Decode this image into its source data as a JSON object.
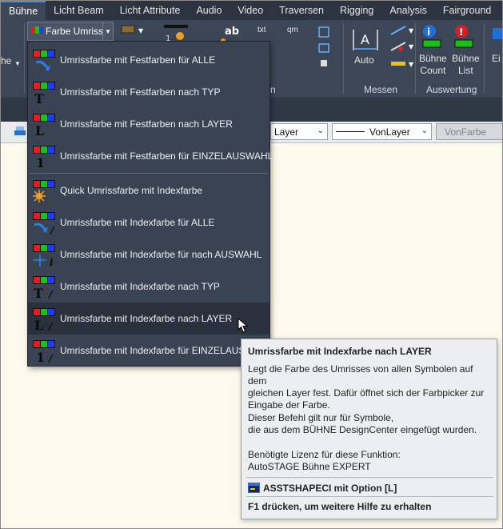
{
  "tabs": [
    {
      "label": "Bühne",
      "active": true
    },
    {
      "label": "Licht Beam"
    },
    {
      "label": "Licht Attribute"
    },
    {
      "label": "Audio"
    },
    {
      "label": "Video"
    },
    {
      "label": "Traversen"
    },
    {
      "label": "Rigging"
    },
    {
      "label": "Analysis"
    },
    {
      "label": "Fairground"
    }
  ],
  "ribbon": {
    "split_button_label": "Farbe Umriss",
    "left_cut_label": "he",
    "panel_cut_label": "n",
    "messen": {
      "label": "Messen",
      "auto_label": "Auto"
    },
    "auswertung": {
      "label": "Auswertung",
      "count_label_1": "Bühne",
      "count_label_2": "Count",
      "list_label_1": "Bühne",
      "list_label_2": "List"
    },
    "right_cut_label": "Ei",
    "small_labels": [
      "txt",
      "qm",
      "ab"
    ]
  },
  "propbar": {
    "layer_value": "Layer",
    "linetype_value": "VonLayer",
    "color_value": "VonFarbe"
  },
  "menu": {
    "items": [
      {
        "label": "Umrissfarbe mit Festfarben für ALLE",
        "icon": "arrow-overlay-icon"
      },
      {
        "label": "Umrissfarbe mit Festfarben nach TYP",
        "icon": "letter-t-icon"
      },
      {
        "label": "Umrissfarbe mit Festfarben nach LAYER",
        "icon": "letter-l-icon"
      },
      {
        "label": "Umrissfarbe mit Festfarben für EINZELAUSWAHL",
        "icon": "number-one-icon"
      },
      {
        "label": "Quick Umrissfarbe mit Indexfarbe",
        "icon": "sparkle-icon"
      },
      {
        "label": "Umrissfarbe mit Indexfarbe für ALLE",
        "icon": "arrow-index-icon"
      },
      {
        "label": "Umrissfarbe mit Indexfarbe für nach AUSWAHL",
        "icon": "crosshair-index-icon"
      },
      {
        "label": "Umrissfarbe mit Indexfarbe nach TYP",
        "icon": "letter-t-index-icon"
      },
      {
        "label": "Umrissfarbe mit Indexfarbe nach LAYER",
        "icon": "letter-l-index-icon",
        "hover": true
      },
      {
        "label": "Umrissfarbe mit Indexfarbe für EINZELAUSWAHL",
        "icon": "number-one-index-icon"
      }
    ]
  },
  "tooltip": {
    "title": "Umrissfarbe mit Indexfarbe nach LAYER",
    "desc_1": "Legt die Farbe des Umrisses von allen Symbolen auf dem",
    "desc_2": "gleichen Layer fest. Dafür öffnet sich der Farbpicker zur",
    "desc_3": "Eingabe der Farbe.",
    "note_1": "Dieser Befehl gilt nur für Symbole,",
    "note_2": "die aus dem BÜHNE DesignCenter eingefügt wurden.",
    "license_1": "Benötigte Lizenz für diese Funktion:",
    "license_2": "AutoSTAGE Bühne EXPERT",
    "command": "ASSTSHAPECI mit Option [L]",
    "help": "F1 drücken, um weitere Hilfe zu erhalten"
  },
  "colors": {
    "red": "#e02020",
    "green": "#18c018",
    "blue": "#1e3cff",
    "tab_bg": "#2b3440",
    "ribbon_bg": "#3c4656",
    "menu_bg": "#3a4353"
  }
}
